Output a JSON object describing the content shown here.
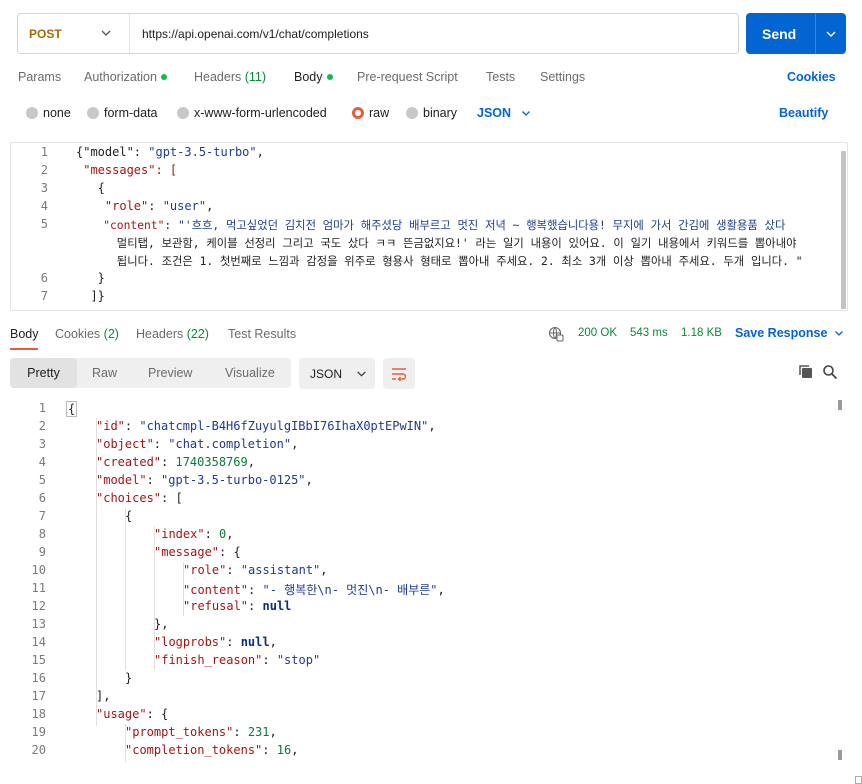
{
  "request": {
    "method": "POST",
    "url": "https://api.openai.com/v1/chat/completions",
    "send_label": "Send"
  },
  "tabs": [
    {
      "label": "Params",
      "dot": false
    },
    {
      "label": "Authorization",
      "dot": true
    },
    {
      "label": "Headers",
      "count": "(11)"
    },
    {
      "label": "Body",
      "dot": true
    },
    {
      "label": "Pre-request Script"
    },
    {
      "label": "Tests"
    },
    {
      "label": "Settings"
    }
  ],
  "cookies_label": "Cookies",
  "body_options": [
    "none",
    "form-data",
    "x-www-form-urlencoded",
    "raw",
    "binary"
  ],
  "body_format": "JSON",
  "beautify_label": "Beautify",
  "request_lines": {
    "n": [
      "1",
      "2",
      "3",
      "4",
      "5",
      "",
      "",
      "6",
      "7"
    ],
    "l1_a": "{\"model\": ",
    "l1_b": "\"gpt-3.5-turbo\"",
    "l1_c": ",",
    "l2_a": " \"messages\": [",
    "l3": "   {",
    "l4_a": "    \"role\"",
    "l4_b": ": ",
    "l4_c": "\"user\"",
    "l4_d": ",",
    "l5_a": "    \"content\"",
    "l5_b": ": ",
    "l5_c": "\"'흐흐, 먹고싶었던 김치전 엄마가 해주셨당 배부르고 멋진 저녁 ~ 행복했습니다용! 무지에 가서 간김에 생활용품 샀다",
    "l5_d": "      멀티탭, 보관함, 케이블 선정리 그리고 국도 샀다 ㅋㅋ 뜬금없지요!' 라는 일기 내용이 있어요. 이 일기 내용에서 키워드를 뽑아내야",
    "l5_e": "      됩니다. 조건은 1. 첫번째로 느낌과 감정을 위주로 형용사 형태로 뽑아내 주세요. 2. 최소 3개 이상 뽑아내 주세요. 두개 입니다. \"",
    "l6": "   }",
    "l7": "  ]}"
  },
  "response_tabs": {
    "body": "Body",
    "cookies": "Cookies",
    "cookies_count": "(2)",
    "headers": "Headers",
    "headers_count": "(22)",
    "tests": "Test Results"
  },
  "status": {
    "code": "200 OK",
    "time": "543 ms",
    "size": "1.18 KB",
    "save": "Save Response"
  },
  "view_modes": [
    "Pretty",
    "Raw",
    "Preview",
    "Visualize"
  ],
  "response_format": "JSON",
  "response_lines": {
    "n": [
      "1",
      "2",
      "3",
      "4",
      "5",
      "6",
      "7",
      "8",
      "9",
      "10",
      "11",
      "12",
      "13",
      "14",
      "15",
      "16",
      "17",
      "18",
      "19",
      "20"
    ],
    "l1": "{",
    "l2_k": "\"id\"",
    "l2_v": "\"chatcmpl-B4H6fZuyulgIBbI76IhaX0ptEPwIN\"",
    "l3_k": "\"object\"",
    "l3_v": "\"chat.completion\"",
    "l4_k": "\"created\"",
    "l4_v": "1740358769",
    "l5_k": "\"model\"",
    "l5_v": "\"gpt-3.5-turbo-0125\"",
    "l6_k": "\"choices\"",
    "l6_v": "[",
    "l7": "{",
    "l8_k": "\"index\"",
    "l8_v": "0",
    "l9_k": "\"message\"",
    "l9_v": "{",
    "l10_k": "\"role\"",
    "l10_v": "\"assistant\"",
    "l11_k": "\"content\"",
    "l11_v": "\"- 행복한\\n- 멋진\\n- 배부른\"",
    "l12_k": "\"refusal\"",
    "l12_v": "null",
    "l13": "},",
    "l14_k": "\"logprobs\"",
    "l14_v": "null",
    "l15_k": "\"finish_reason\"",
    "l15_v": "\"stop\"",
    "l16": "}",
    "l17": "],",
    "l18_k": "\"usage\"",
    "l18_v": "{",
    "l19_k": "\"prompt_tokens\"",
    "l19_v": "231",
    "l20_k": "\"completion_tokens\"",
    "l20_v": "16"
  }
}
